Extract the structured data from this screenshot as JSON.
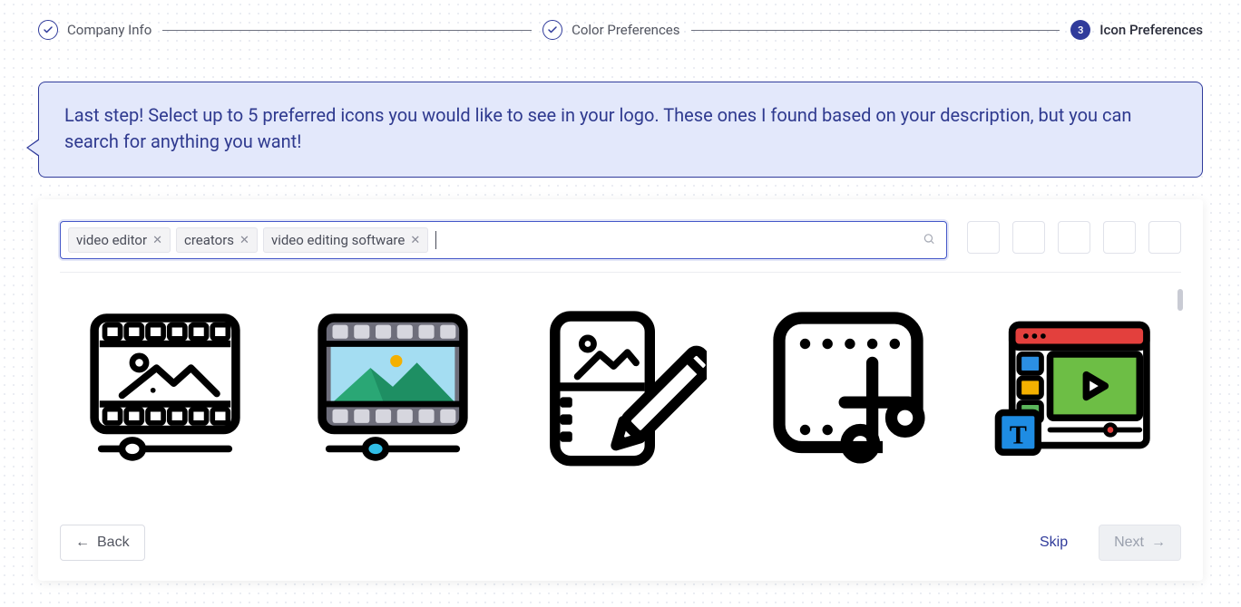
{
  "steps": [
    {
      "label": "Company Info",
      "state": "done",
      "mark": "✓"
    },
    {
      "label": "Color Preferences",
      "state": "done",
      "mark": "✓"
    },
    {
      "label": "Icon Preferences",
      "state": "current",
      "mark": "3"
    }
  ],
  "instruction": "Last step! Select up to 5 preferred icons you would like to see in your logo. These ones I found based on your description, but you can search for anything you want!",
  "search": {
    "tags": [
      "video editor",
      "creators",
      "video editing software"
    ],
    "placeholder": ""
  },
  "selected_slot_count": 5,
  "icons": [
    {
      "name": "film-frame-outline-icon"
    },
    {
      "name": "film-frame-color-icon"
    },
    {
      "name": "film-strip-edit-icon"
    },
    {
      "name": "crop-cut-icon"
    },
    {
      "name": "video-editor-app-icon"
    }
  ],
  "buttons": {
    "back": "Back",
    "skip": "Skip",
    "next": "Next"
  }
}
